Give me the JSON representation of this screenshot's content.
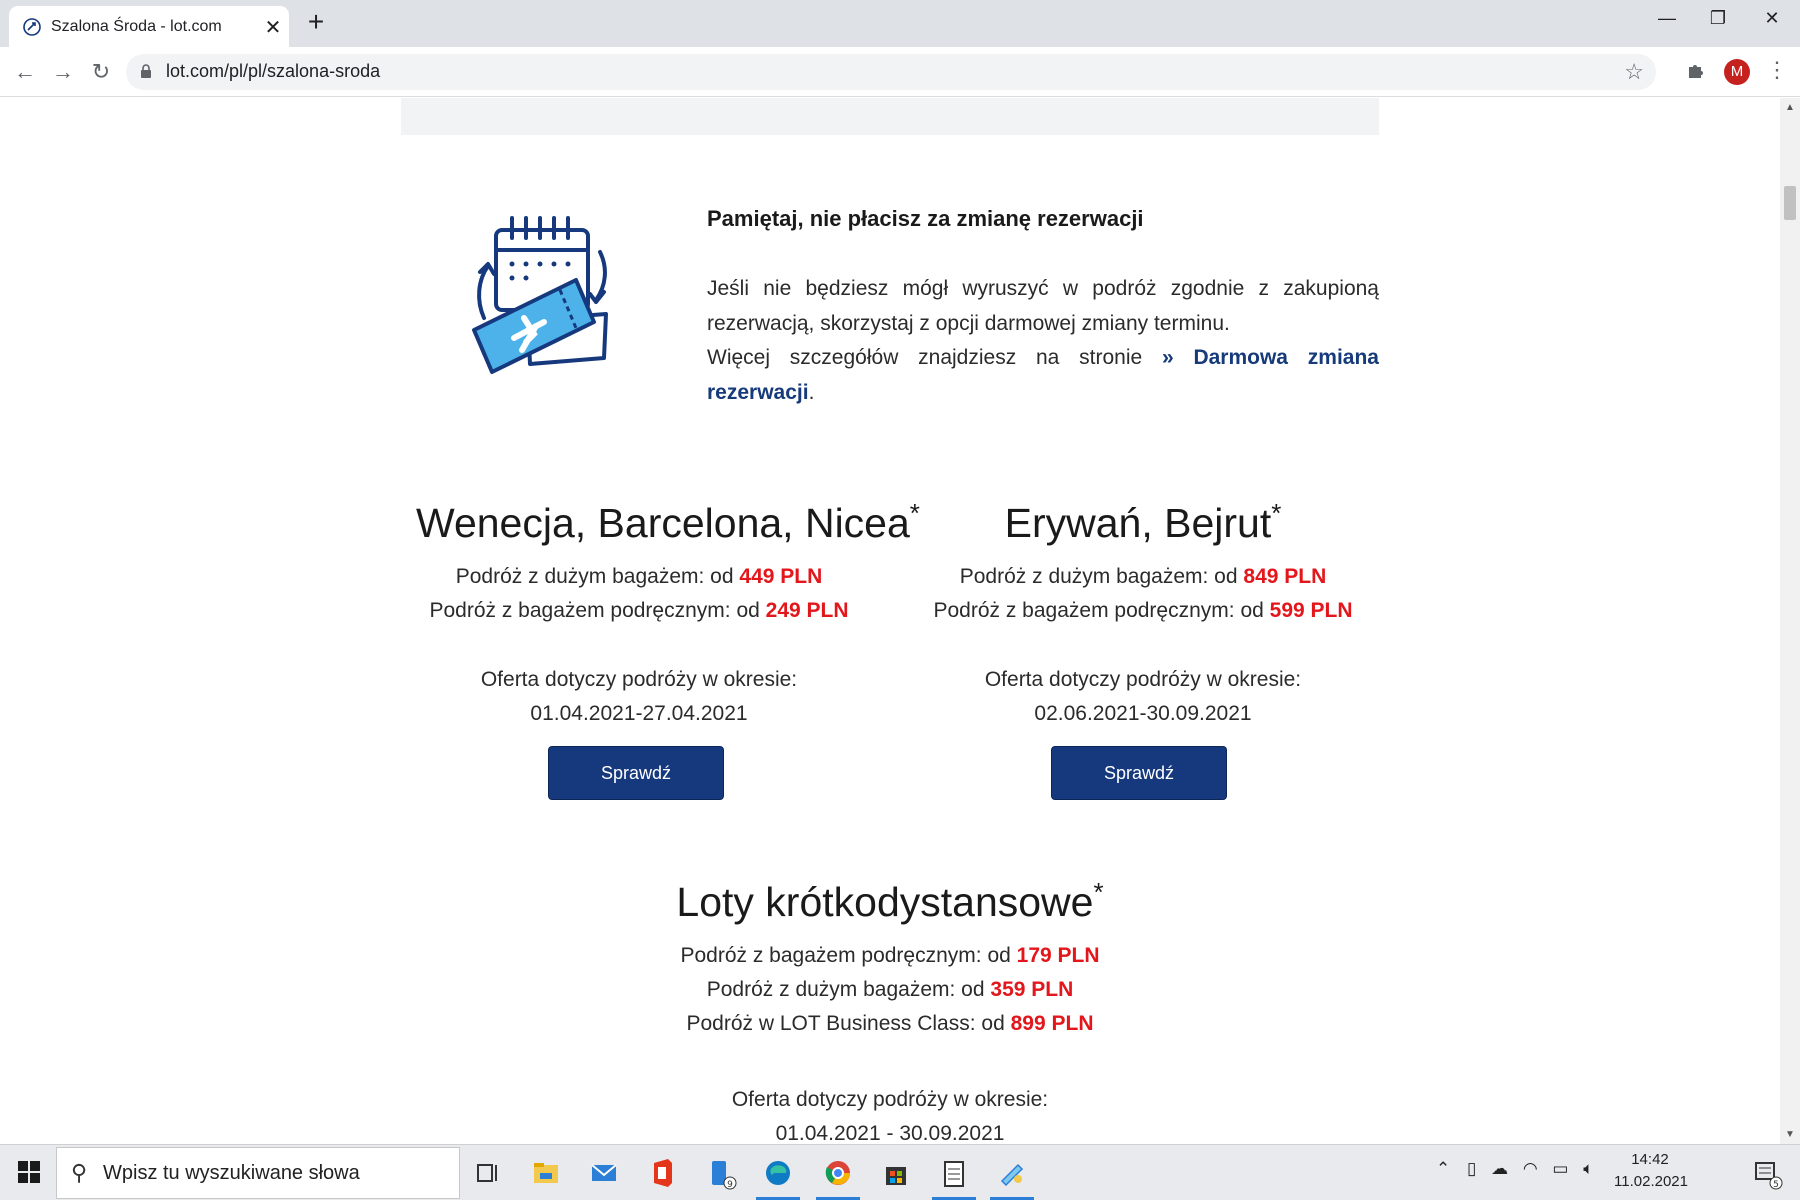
{
  "browser": {
    "tab_title": "Szalona Środa - lot.com",
    "tab_close": "✕",
    "new_tab": "+",
    "url": "lot.com/pl/pl/szalona-sroda",
    "avatar_letter": "M",
    "window_controls": {
      "minimize": "—",
      "restore": "❐",
      "close": "✕"
    }
  },
  "note": {
    "heading": "Pamiętaj, nie płacisz za zmianę rezerwacji",
    "line1": "Jeśli nie będziesz mógł wyruszyć w podróż zgodnie z zakupioną rezerwacją, skorzystaj z opcji darmowej zmiany terminu.",
    "line2_prefix": "Więcej szczegółów znajdziesz na stronie",
    "link_text": "» Darmowa zmiana rezerwacji",
    "line2_suffix": "."
  },
  "offers": [
    {
      "title": "Wenecja, Barcelona, Nicea",
      "asterisk": "*",
      "line1_label": "Podróż z dużym bagażem: od",
      "line1_price": "449 PLN",
      "line2_label": "Podróż z bagażem podręcznym: od",
      "line2_price": "249 PLN",
      "period_label": "Oferta dotyczy podróży w okresie:",
      "period": "01.04.2021-27.04.2021",
      "button": "Sprawdź"
    },
    {
      "title": "Erywań, Bejrut",
      "asterisk": "*",
      "line1_label": "Podróż z dużym bagażem: od",
      "line1_price": "849 PLN",
      "line2_label": "Podróż z bagażem podręcznym: od",
      "line2_price": "599 PLN",
      "period_label": "Oferta dotyczy podróży w okresie:",
      "period": "02.06.2021-30.09.2021",
      "button": "Sprawdź"
    },
    {
      "title": "Loty krótkodystansowe",
      "asterisk": "*",
      "line1_label": "Podróż z bagażem podręcznym: od",
      "line1_price": "179 PLN",
      "line2_label": "Podróż z dużym bagażem: od",
      "line2_price": "359 PLN",
      "line3_label": "Podróż w LOT Business Class: od",
      "line3_price": "899 PLN",
      "period_label": "Oferta dotyczy podróży w okresie:",
      "period": "01.04.2021 - 30.09.2021"
    }
  ],
  "taskbar": {
    "search_placeholder": "Wpisz tu wyszukiwane słowa",
    "store_badge": "9",
    "time": "14:42",
    "date": "11.02.2021",
    "notification_count": "5",
    "icons": [
      "task-view-icon",
      "file-explorer-icon",
      "mail-icon",
      "office-icon",
      "phone-app-icon",
      "edge-icon",
      "chrome-icon",
      "store-icon",
      "notepad-icon",
      "paint-icon"
    ]
  },
  "colors": {
    "price": "#e3161b",
    "button": "#16397e",
    "link": "#163a7a"
  }
}
